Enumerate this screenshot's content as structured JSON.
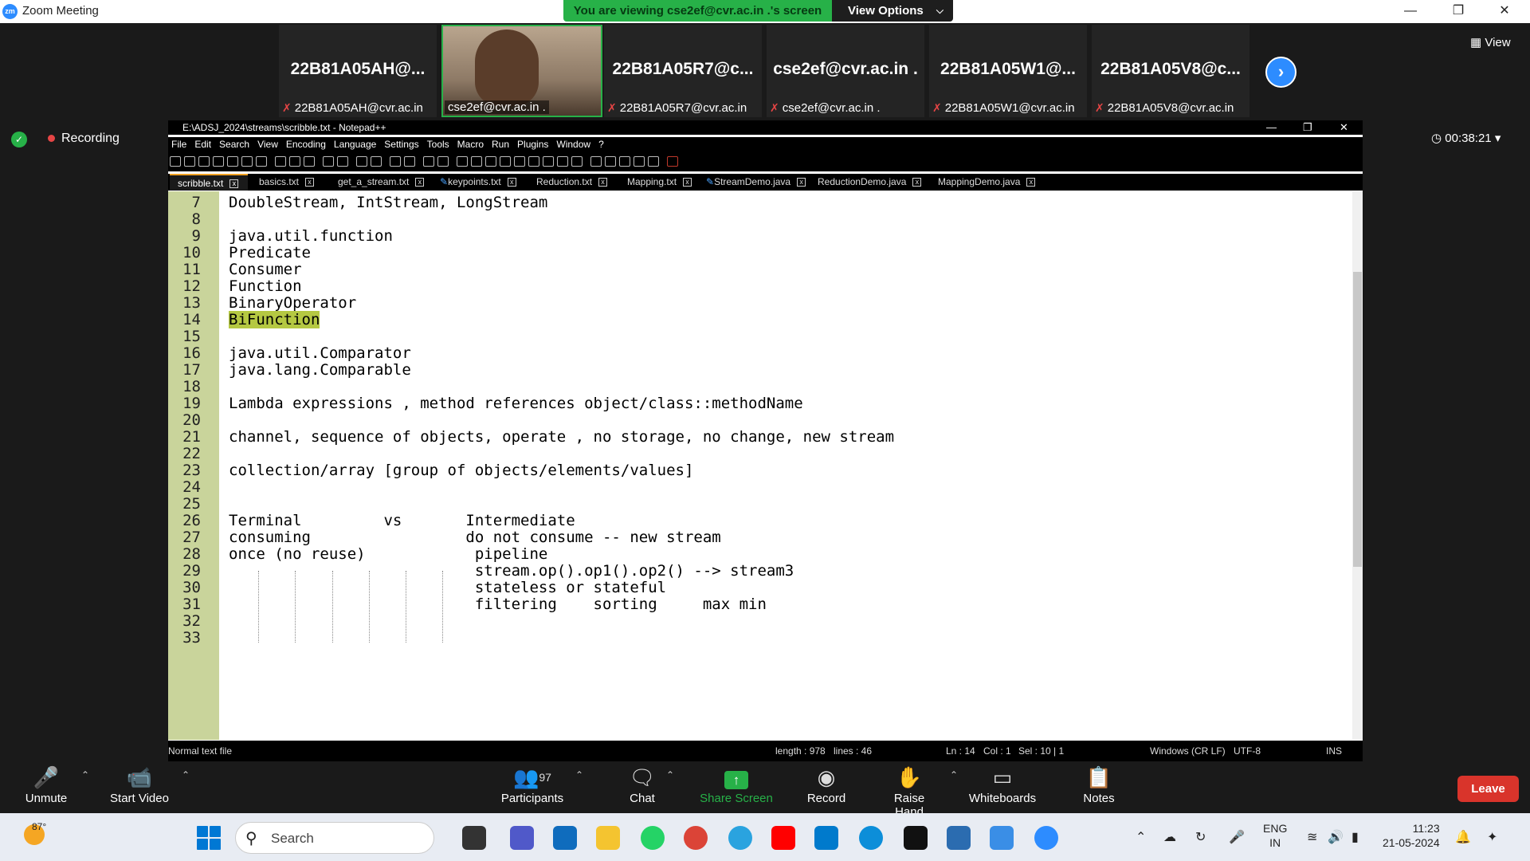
{
  "zoom": {
    "window_title": "Zoom Meeting",
    "logo_text": "zm",
    "share_banner": "You are viewing cse2ef@cvr.ac.in .'s screen",
    "view_options_label": "View Options",
    "view_label": "View",
    "recording_label": "Recording",
    "timer": "00:38:21",
    "participants": [
      {
        "name": "22B81A05AH@...",
        "label": "22B81A05AH@cvr.ac.in"
      },
      {
        "name": "22B81A05R7@c...",
        "label": "22B81A05R7@cvr.ac.in"
      },
      {
        "name": "cse2ef@cvr.ac.in .",
        "label": "cse2ef@cvr.ac.in ."
      },
      {
        "name": "22B81A05W1@...",
        "label": "22B81A05W1@cvr.ac.in"
      },
      {
        "name": "22B81A05V8@c...",
        "label": "22B81A05V8@cvr.ac.in"
      }
    ],
    "host_label": "cse2ef@cvr.ac.in .",
    "controls": {
      "unmute": "Unmute",
      "start_video": "Start Video",
      "participants": "Participants",
      "participants_count": "97",
      "chat": "Chat",
      "share_screen": "Share Screen",
      "record": "Record",
      "raise_hand": "Raise Hand",
      "whiteboards": "Whiteboards",
      "notes": "Notes",
      "leave": "Leave"
    }
  },
  "npp": {
    "title": "E:\\ADSJ_2024\\streams\\scribble.txt - Notepad++",
    "menu": [
      "File",
      "Edit",
      "Search",
      "View",
      "Encoding",
      "Language",
      "Settings",
      "Tools",
      "Macro",
      "Run",
      "Plugins",
      "Window",
      "?"
    ],
    "tabs": [
      "scribble.txt",
      "basics.txt",
      "get_a_stream.txt",
      "keypoints.txt",
      "Reduction.txt",
      "Mapping.txt",
      "StreamDemo.java",
      "ReductionDemo.java",
      "MappingDemo.java"
    ],
    "lines": [
      {
        "n": "7",
        "text": "DoubleStream, IntStream, LongStream"
      },
      {
        "n": "8",
        "text": ""
      },
      {
        "n": "9",
        "text": "java.util.function"
      },
      {
        "n": "10",
        "text": "Predicate"
      },
      {
        "n": "11",
        "text": "Consumer"
      },
      {
        "n": "12",
        "text": "Function"
      },
      {
        "n": "13",
        "text": "BinaryOperator"
      },
      {
        "n": "14",
        "text": "BiFunction"
      },
      {
        "n": "15",
        "text": ""
      },
      {
        "n": "16",
        "text": "java.util.Comparator"
      },
      {
        "n": "17",
        "text": "java.lang.Comparable"
      },
      {
        "n": "18",
        "text": ""
      },
      {
        "n": "19",
        "text": "Lambda expressions , method references object/class::methodName"
      },
      {
        "n": "20",
        "text": ""
      },
      {
        "n": "21",
        "text": "channel, sequence of objects, operate , no storage, no change, new stream"
      },
      {
        "n": "22",
        "text": ""
      },
      {
        "n": "23",
        "text": "collection/array [group of objects/elements/values]"
      },
      {
        "n": "24",
        "text": ""
      },
      {
        "n": "25",
        "text": ""
      },
      {
        "n": "26",
        "text": "Terminal         vs       Intermediate"
      },
      {
        "n": "27",
        "text": "consuming                 do not consume -- new stream"
      },
      {
        "n": "28",
        "text": "once (no reuse)            pipeline"
      },
      {
        "n": "29",
        "text": "                           stream.op().op1().op2() --> stream3"
      },
      {
        "n": "30",
        "text": "                           stateless or stateful"
      },
      {
        "n": "31",
        "text": "                           filtering    sorting     max min"
      },
      {
        "n": "32",
        "text": ""
      },
      {
        "n": "33",
        "text": ""
      }
    ],
    "status": {
      "file_type": "Normal text file",
      "length": "length : 978",
      "lines": "lines : 46",
      "ln": "Ln : 14",
      "col": "Col : 1",
      "sel": "Sel : 10 | 1",
      "eol": "Windows (CR LF)",
      "encoding": "UTF-8",
      "mode": "INS"
    }
  },
  "taskbar": {
    "temperature": "87°",
    "search_placeholder": "Search",
    "lang_line1": "ENG",
    "lang_line2": "IN",
    "time": "11:23",
    "date": "21-05-2024"
  },
  "colors": {
    "zoom_blue": "#2d8cff",
    "share_green": "#27b148",
    "leave_red": "#d9342b",
    "gutter": "#c9d49b",
    "highlight": "#b5c842"
  }
}
